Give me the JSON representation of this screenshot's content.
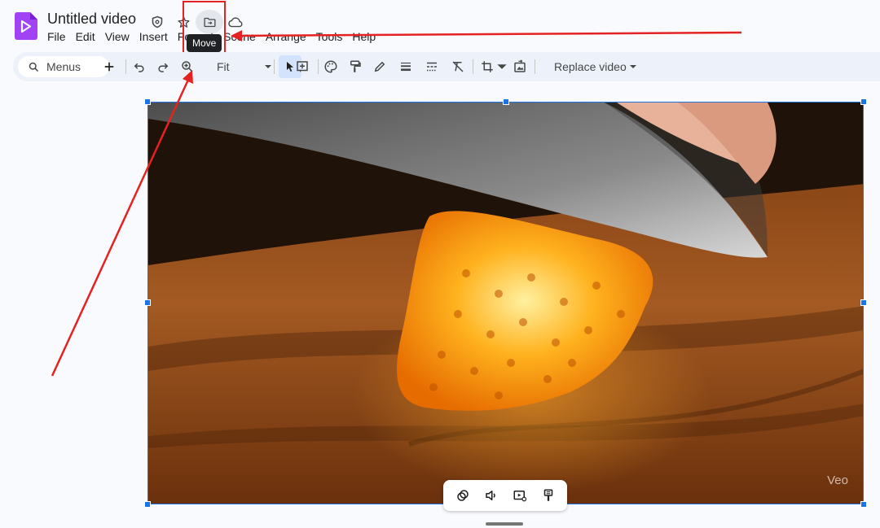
{
  "app": {
    "title": "Untitled video"
  },
  "menu": [
    "File",
    "Edit",
    "View",
    "Insert",
    "Format",
    "Scene",
    "Arrange",
    "Tools",
    "Help"
  ],
  "tooltip": {
    "text": "Move"
  },
  "toolbar": {
    "search_label": "Menus",
    "zoom_value": "Fit",
    "replace_label": "Replace video"
  },
  "video": {
    "watermark": "Veo"
  },
  "colors": {
    "accent": "#1a73e8",
    "annotation": "#e52222",
    "app_icon": "#a142f4"
  },
  "icons": {
    "title_actions": [
      "shield-icon",
      "star-icon",
      "move-folder-icon",
      "cloud-icon"
    ],
    "toolbar": [
      "search-icon",
      "add-icon",
      "undo-icon",
      "redo-icon",
      "zoom-icon",
      "select-icon",
      "add-text-icon",
      "palette-icon",
      "paint-format-icon",
      "pen-icon",
      "line-weight-icon",
      "line-dash-icon",
      "clear-format-icon",
      "crop-icon",
      "reset-image-icon"
    ],
    "video_controls": [
      "animation-icon",
      "volume-icon",
      "playback-icon",
      "format-icon"
    ]
  }
}
